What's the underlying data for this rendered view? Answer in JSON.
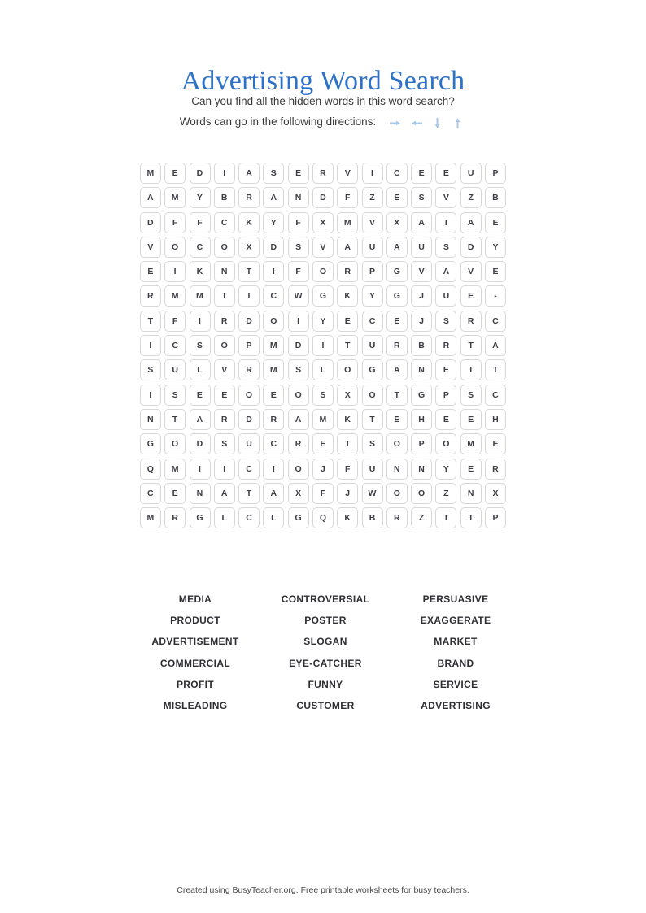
{
  "title": "Advertising Word Search",
  "intro": {
    "line1": "Can you find all the hidden words in this word search?",
    "line2": "Words can go in the following directions:"
  },
  "directions": [
    {
      "name": "arrow-right-icon",
      "label": "right",
      "glyph": "→"
    },
    {
      "name": "arrow-left-icon",
      "label": "left",
      "glyph": "←"
    },
    {
      "name": "arrow-down-icon",
      "label": "down",
      "glyph": "↓"
    },
    {
      "name": "arrow-up-icon",
      "label": "up",
      "glyph": "↑"
    }
  ],
  "colors": {
    "title": "#2e72c8",
    "arrow": "#a8c8e8",
    "cell_border": "#d8d8d8",
    "letter": "#3d3d46",
    "word": "#2f2f33",
    "footer": "#4a4a4a"
  },
  "grid": {
    "rows": 15,
    "cols": 15,
    "letters": [
      [
        "M",
        "E",
        "D",
        "I",
        "A",
        "S",
        "E",
        "R",
        "V",
        "I",
        "C",
        "E",
        "E",
        "U",
        "P"
      ],
      [
        "A",
        "M",
        "Y",
        "B",
        "R",
        "A",
        "N",
        "D",
        "F",
        "Z",
        "E",
        "S",
        "V",
        "Z",
        "B"
      ],
      [
        "D",
        "F",
        "F",
        "C",
        "K",
        "Y",
        "F",
        "X",
        "M",
        "V",
        "X",
        "A",
        "I",
        "A",
        "E"
      ],
      [
        "V",
        "O",
        "C",
        "O",
        "X",
        "D",
        "S",
        "V",
        "A",
        "U",
        "A",
        "U",
        "S",
        "D",
        "Y"
      ],
      [
        "E",
        "I",
        "K",
        "N",
        "T",
        "I",
        "F",
        "O",
        "R",
        "P",
        "G",
        "V",
        "A",
        "V",
        "E"
      ],
      [
        "R",
        "M",
        "M",
        "T",
        "I",
        "C",
        "W",
        "G",
        "K",
        "Y",
        "G",
        "J",
        "U",
        "E",
        "-"
      ],
      [
        "T",
        "F",
        "I",
        "R",
        "D",
        "O",
        "I",
        "Y",
        "E",
        "C",
        "E",
        "J",
        "S",
        "R",
        "C"
      ],
      [
        "I",
        "C",
        "S",
        "O",
        "P",
        "M",
        "D",
        "I",
        "T",
        "U",
        "R",
        "B",
        "R",
        "T",
        "A"
      ],
      [
        "S",
        "U",
        "L",
        "V",
        "R",
        "M",
        "S",
        "L",
        "O",
        "G",
        "A",
        "N",
        "E",
        "I",
        "T"
      ],
      [
        "I",
        "S",
        "E",
        "E",
        "O",
        "E",
        "O",
        "S",
        "X",
        "O",
        "T",
        "G",
        "P",
        "S",
        "C"
      ],
      [
        "N",
        "T",
        "A",
        "R",
        "D",
        "R",
        "A",
        "M",
        "K",
        "T",
        "E",
        "H",
        "E",
        "E",
        "H"
      ],
      [
        "G",
        "O",
        "D",
        "S",
        "U",
        "C",
        "R",
        "E",
        "T",
        "S",
        "O",
        "P",
        "O",
        "M",
        "E"
      ],
      [
        "Q",
        "M",
        "I",
        "I",
        "C",
        "I",
        "O",
        "J",
        "F",
        "U",
        "N",
        "N",
        "Y",
        "E",
        "R"
      ],
      [
        "C",
        "E",
        "N",
        "A",
        "T",
        "A",
        "X",
        "F",
        "J",
        "W",
        "O",
        "O",
        "Z",
        "N",
        "X"
      ],
      [
        "M",
        "R",
        "G",
        "L",
        "C",
        "L",
        "G",
        "Q",
        "K",
        "B",
        "R",
        "Z",
        "T",
        "T",
        "P"
      ]
    ]
  },
  "wordlist": [
    "MEDIA",
    "CONTROVERSIAL",
    "PERSUASIVE",
    "PRODUCT",
    "POSTER",
    "EXAGGERATE",
    "ADVERTISEMENT",
    "SLOGAN",
    "MARKET",
    "COMMERCIAL",
    "EYE-CATCHER",
    "BRAND",
    "PROFIT",
    "FUNNY",
    "SERVICE",
    "MISLEADING",
    "CUSTOMER",
    "ADVERTISING"
  ],
  "footer": "Created using BusyTeacher.org. Free printable worksheets for busy teachers."
}
